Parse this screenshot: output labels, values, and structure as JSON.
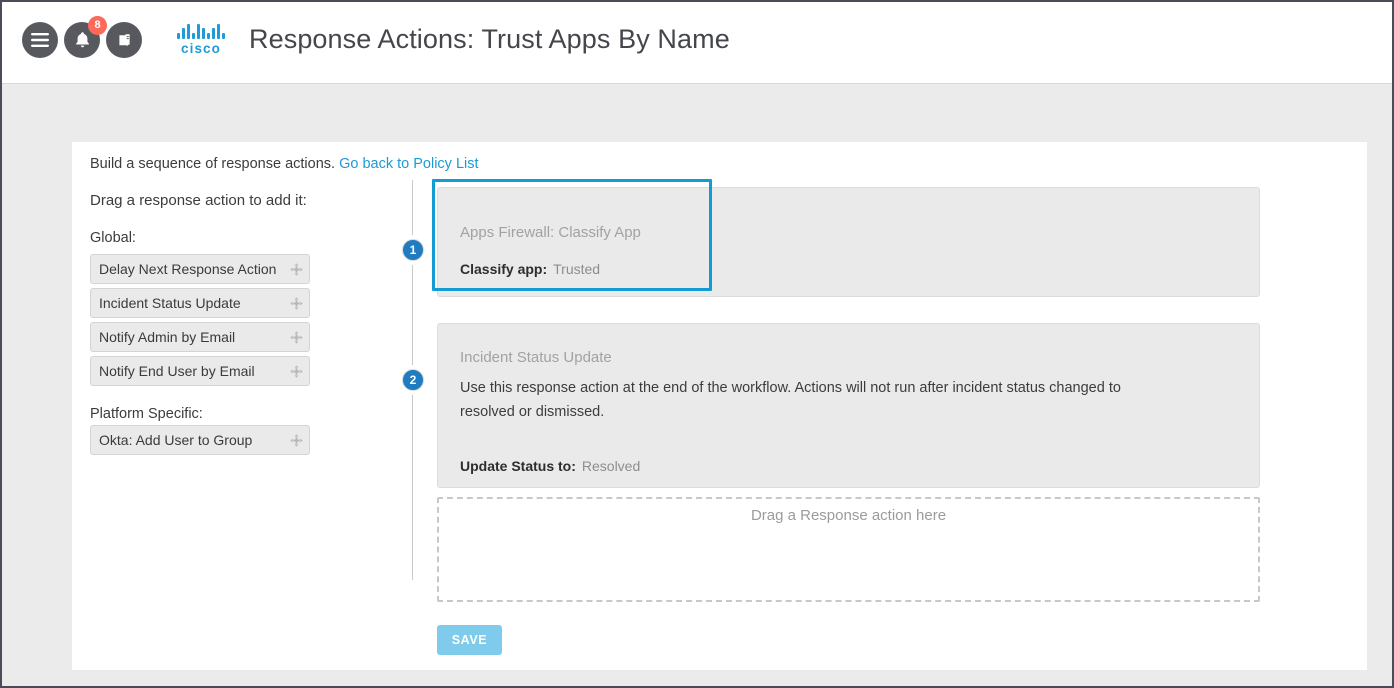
{
  "header": {
    "title": "Response Actions: Trust Apps By Name",
    "brand": "cisco",
    "menu_icon": "hamburger-menu-icon",
    "bell_icon": "notification-bell-icon",
    "notification_count": "8",
    "docs_icon": "book-docs-icon"
  },
  "content": {
    "intro_text": "Build a sequence of response actions.",
    "intro_link": "Go back to Policy List",
    "drag_hint": "Drag a response action to add it:",
    "groups": [
      {
        "label": "Global:",
        "items": [
          {
            "label": "Delay Next Response Action",
            "handle_icon": "move-handle-icon"
          },
          {
            "label": "Incident Status Update",
            "handle_icon": "move-handle-icon"
          },
          {
            "label": "Notify Admin by Email",
            "handle_icon": "move-handle-icon"
          },
          {
            "label": "Notify End User by Email",
            "handle_icon": "move-handle-icon"
          }
        ]
      },
      {
        "label": "Platform Specific:",
        "items": [
          {
            "label": "Okta: Add User to Group",
            "handle_icon": "move-handle-icon"
          }
        ]
      }
    ]
  },
  "sequence": {
    "steps": [
      {
        "number": "1",
        "title": "Apps Firewall: Classify App",
        "description": "",
        "field_label": "Classify app:",
        "field_value": "Trusted",
        "selected": true
      },
      {
        "number": "2",
        "title": "Incident Status Update",
        "description": "Use this response action at the end of the workflow. Actions will not run after incident status changed to resolved or dismissed.",
        "field_label": "Update Status to:",
        "field_value": "Resolved",
        "selected": false
      }
    ],
    "dropzone_text": "Drag a Response action here",
    "save_label": "SAVE"
  },
  "colors": {
    "accent_blue": "#139bd4",
    "link_blue": "#1d9ad6",
    "badge_blue": "#1f7cc0",
    "save_blue": "#7fcbeb",
    "notification_red": "#fc6a5a",
    "card_gray": "#eaeaea",
    "page_bg": "#ebebeb"
  }
}
